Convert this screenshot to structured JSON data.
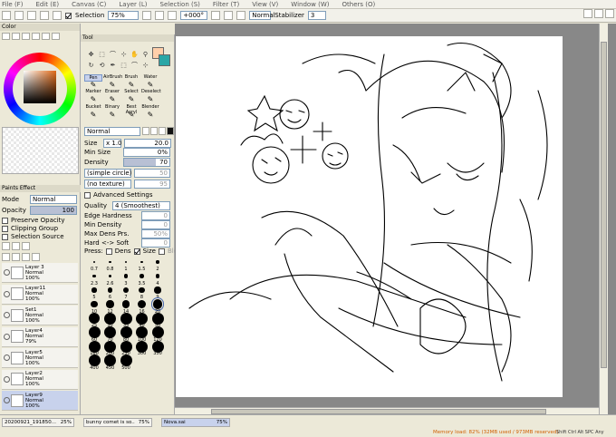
{
  "menubar": {
    "items": [
      "File (F)",
      "Edit (E)",
      "Canvas (C)",
      "Layer (L)",
      "Selection (S)",
      "Filter (T)",
      "View (V)",
      "Window (W)",
      "Others (O)"
    ]
  },
  "toolbar": {
    "selection_label": "Selection",
    "zoom": "75%",
    "rotation": "+000°",
    "blend": "Normal",
    "stabilizer_label": "Stabilizer",
    "stabilizer_value": "3"
  },
  "color_panel": {
    "title": "Color",
    "fg_color": "#ffcfaa",
    "bg_color": "#2aa6a6"
  },
  "paints_effect": {
    "title": "Paints Effect",
    "mode_label": "Mode",
    "mode_value": "Normal",
    "opacity_label": "Opacity",
    "opacity_value": "100",
    "opacity_level": 1.0,
    "preserve_opacity": "Preserve Opacity",
    "clipping_group": "Clipping Group",
    "selection_source": "Selection Source"
  },
  "layers": [
    {
      "name": "Layer 3",
      "mode": "Normal",
      "opacity": "100%",
      "selected": false
    },
    {
      "name": "Layer11",
      "mode": "Normal",
      "opacity": "100%",
      "selected": false
    },
    {
      "name": "Set1",
      "mode": "Normal",
      "opacity": "100%",
      "selected": false
    },
    {
      "name": "Layer4",
      "mode": "Normal",
      "opacity": "79%",
      "selected": false
    },
    {
      "name": "Layer5",
      "mode": "Normal",
      "opacity": "100%",
      "selected": false
    },
    {
      "name": "Layer2",
      "mode": "Normal",
      "opacity": "100%",
      "selected": false
    },
    {
      "name": "Layer9",
      "mode": "Normal",
      "opacity": "100%",
      "selected": true
    }
  ],
  "tool_panel": {
    "title": "Tool",
    "brushes_row1": [
      "Pen",
      "AirBrush",
      "Brush",
      "Water"
    ],
    "brushes_row2": [
      "Marker",
      "Eraser",
      "Select",
      "Deselect"
    ],
    "brushes_row3": [
      "Bucket",
      "Binary",
      "Best Acryl",
      "Blender"
    ],
    "blend_mode": "Normal",
    "size_label": "Size",
    "size_mult": "x 1.0",
    "size_value": "20.0",
    "minsize_label": "Min Size",
    "minsize_value": "0%",
    "density_label": "Density",
    "density_value": "70",
    "density_level": 0.7,
    "shape": "(simple circle)",
    "shape_value": "50",
    "texture": "(no texture)",
    "texture_value": "95",
    "adv_label": "Advanced Settings",
    "quality_label": "Quality",
    "quality_value": "4 (Smoothest)",
    "edge_label": "Edge Hardness",
    "edge_value": "0",
    "min_density_label": "Min Density",
    "min_density_value": "0",
    "max_dens_label": "Max Dens Prs.",
    "max_dens_value": "50%",
    "hard_soft_label": "Hard <-> Soft",
    "hard_soft_value": "0",
    "press_label": "Press:",
    "press_dens": "Dens",
    "press_size": "Size",
    "press_blend": "Blend",
    "sizes": [
      "0.7",
      "0.8",
      "1",
      "1.5",
      "2",
      "2.3",
      "2.6",
      "3",
      "3.5",
      "4",
      "5",
      "6",
      "7",
      "8",
      "9",
      "10",
      "12",
      "14",
      "16",
      "20",
      "25",
      "30",
      "35",
      "40",
      "50",
      "60",
      "70",
      "80",
      "100",
      "120",
      "160",
      "200",
      "250",
      "300",
      "350",
      "400",
      "450",
      "500"
    ]
  },
  "file_tabs": [
    {
      "name": "20200921_191850...",
      "zoom": "25%"
    },
    {
      "name": "bunny comet is so...",
      "zoom": "75%"
    },
    {
      "name": "Nova.sai",
      "zoom": "75%"
    }
  ],
  "status": {
    "memory": "Memory load: 82% (32MB used / 973MB reserved)",
    "keys": "Shift Ctrl Alt SPC Any"
  }
}
